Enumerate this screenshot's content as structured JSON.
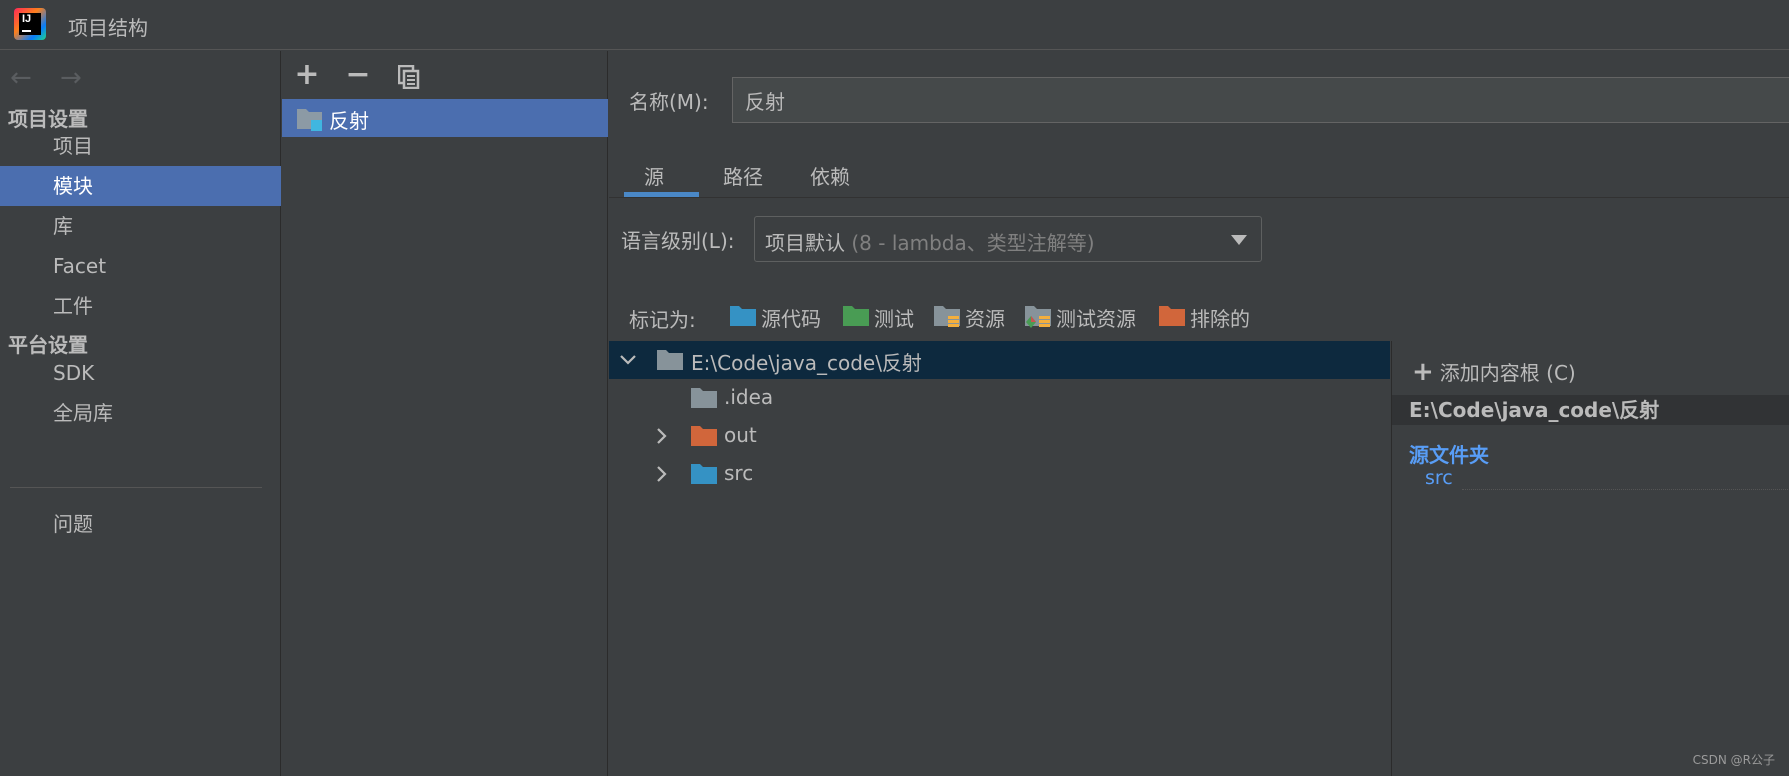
{
  "window": {
    "title": "项目结构",
    "logo_text": "IJ"
  },
  "nav": {
    "back_icon": "arrow-left-icon",
    "forward_icon": "arrow-right-icon"
  },
  "sidebar": {
    "project_settings_heading": "项目设置",
    "project_items": [
      {
        "label": "项目",
        "selected": false
      },
      {
        "label": "模块",
        "selected": true
      },
      {
        "label": "库",
        "selected": false
      },
      {
        "label": "Facet",
        "selected": false
      },
      {
        "label": "工件",
        "selected": false
      }
    ],
    "platform_settings_heading": "平台设置",
    "platform_items": [
      {
        "label": "SDK"
      },
      {
        "label": "全局库"
      }
    ],
    "problems_label": "问题"
  },
  "modules_panel": {
    "toolbar": {
      "add": "+",
      "remove": "−",
      "copy_icon": "copy-icon"
    },
    "modules": [
      {
        "label": "反射",
        "selected": true
      }
    ]
  },
  "module": {
    "name_label": "名称(M):",
    "name_value": "反射",
    "tabs": [
      {
        "label": "源",
        "active": true
      },
      {
        "label": "路径",
        "active": false
      },
      {
        "label": "依赖",
        "active": false
      }
    ],
    "language_level_label": "语言级别(L):",
    "language_level_value": "项目默认",
    "language_level_hint": "(8 - lambda、类型注解等)",
    "mark_as_label": "标记为:",
    "mark_as": [
      {
        "label": "源代码",
        "color": "#3592c4"
      },
      {
        "label": "测试",
        "color": "#499c54"
      },
      {
        "label": "资源",
        "color": "#87939a"
      },
      {
        "label": "测试资源",
        "color": "#87939a"
      },
      {
        "label": "排除的",
        "color": "#c75450"
      }
    ],
    "tree": {
      "root": "E:\\Code\\java_code\\反射",
      "children": [
        {
          "label": ".idea",
          "expandable": false,
          "color": "#87939a"
        },
        {
          "label": "out",
          "expandable": true,
          "color": "#c75450"
        },
        {
          "label": "src",
          "expandable": true,
          "color": "#3592c4"
        }
      ]
    },
    "content_roots": {
      "add_label": "添加内容根 (C)",
      "root_path": "E:\\Code\\java_code\\反射",
      "source_folders_heading": "源文件夹",
      "source_folders": [
        "src"
      ]
    }
  },
  "watermark": "CSDN @R公子"
}
